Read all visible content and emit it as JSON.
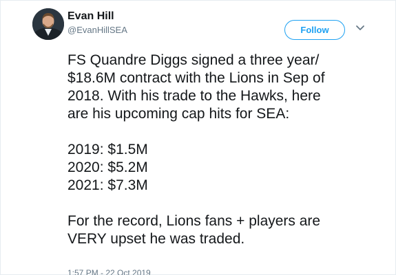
{
  "author": {
    "name": "Evan Hill",
    "handle": "@EvanHillSEA",
    "avatar_icon": "avatar-photo"
  },
  "actions": {
    "follow_label": "Follow",
    "menu_icon": "chevron-down-icon"
  },
  "tweet": {
    "paragraph1": [
      "FS Quandre Diggs signed a three year/",
      "$18.6M contract with the Lions in Sep of",
      "2018. With his trade to the Hawks, here",
      "are his upcoming cap hits for SEA:"
    ],
    "cap_hits": [
      "2019: $1.5M",
      "2020: $5.2M",
      "2021: $7.3M"
    ],
    "paragraph3": [
      "For the record, Lions fans + players are",
      "VERY upset he was traded."
    ]
  },
  "timestamp": "1:57 PM - 22 Oct 2019",
  "colors": {
    "accent": "#1da1f2",
    "secondary_text": "#657786",
    "primary_text": "#14171a"
  }
}
